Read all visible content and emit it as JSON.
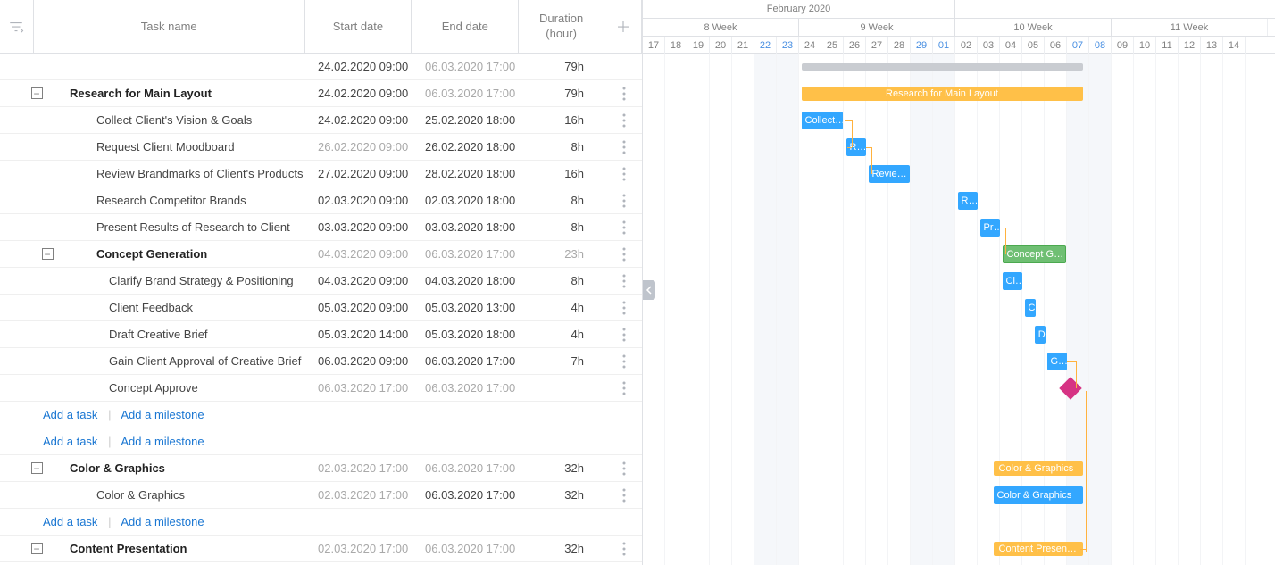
{
  "header": {
    "task_name": "Task name",
    "start_date": "Start date",
    "end_date": "End date",
    "duration_l1": "Duration",
    "duration_l2": "(hour)"
  },
  "timeline_header": {
    "month": "February 2020",
    "weeks": [
      "8 Week",
      "9 Week",
      "10 Week",
      "11 Week"
    ],
    "days": [
      "17",
      "18",
      "19",
      "20",
      "21",
      "22",
      "23",
      "24",
      "25",
      "26",
      "27",
      "28",
      "29",
      "01",
      "02",
      "03",
      "04",
      "05",
      "06",
      "07",
      "08",
      "09",
      "10",
      "11",
      "12",
      "13",
      "14"
    ]
  },
  "links": {
    "add_task": "Add a task",
    "add_milestone": "Add a milestone"
  },
  "rows": [
    {
      "id": "root",
      "lvl": 0,
      "name": "",
      "start": "24.02.2020 09:00",
      "end": "06.03.2020 17:00",
      "dur": "79h"
    },
    {
      "id": "research",
      "lvl": 1,
      "name": "Research for Main Layout",
      "start": "24.02.2020 09:00",
      "end": "06.03.2020 17:00",
      "dur": "79h",
      "summary": true
    },
    {
      "id": "collect",
      "lvl": 2,
      "name": "Collect Client's Vision & Goals",
      "start": "24.02.2020 09:00",
      "end": "25.02.2020 18:00",
      "dur": "16h"
    },
    {
      "id": "mood",
      "lvl": 2,
      "name": "Request Client Moodboard",
      "start": "26.02.2020 09:00",
      "end": "26.02.2020 18:00",
      "dur": "8h",
      "dim_start": true
    },
    {
      "id": "brand",
      "lvl": 2,
      "name": "Review Brandmarks of Client's Products",
      "start": "27.02.2020 09:00",
      "end": "28.02.2020 18:00",
      "dur": "16h"
    },
    {
      "id": "comp",
      "lvl": 2,
      "name": "Research Competitor Brands",
      "start": "02.03.2020 09:00",
      "end": "02.03.2020 18:00",
      "dur": "8h"
    },
    {
      "id": "present",
      "lvl": 2,
      "name": "Present Results of Research to Client",
      "start": "03.03.2020 09:00",
      "end": "03.03.2020 18:00",
      "dur": "8h"
    },
    {
      "id": "concept",
      "lvl": 2,
      "name": "Concept Generation",
      "start": "04.03.2020 09:00",
      "end": "06.03.2020 17:00",
      "dur": "23h",
      "summary": true,
      "dim": true
    },
    {
      "id": "clarify",
      "lvl": 3,
      "name": "Clarify Brand Strategy & Positioning",
      "start": "04.03.2020 09:00",
      "end": "04.03.2020 18:00",
      "dur": "8h"
    },
    {
      "id": "feedback",
      "lvl": 3,
      "name": "Client Feedback",
      "start": "05.03.2020 09:00",
      "end": "05.03.2020 13:00",
      "dur": "4h"
    },
    {
      "id": "draft",
      "lvl": 3,
      "name": "Draft Creative Brief",
      "start": "05.03.2020 14:00",
      "end": "05.03.2020 18:00",
      "dur": "4h"
    },
    {
      "id": "approval",
      "lvl": 3,
      "name": "Gain Client Approval of Creative Brief",
      "start": "06.03.2020 09:00",
      "end": "06.03.2020 17:00",
      "dur": "7h"
    },
    {
      "id": "approve",
      "lvl": 3,
      "name": "Concept Approve",
      "start": "06.03.2020 17:00",
      "end": "06.03.2020 17:00",
      "dur": "",
      "dim": true
    },
    {
      "id": "color",
      "lvl": 1,
      "name": "Color & Graphics",
      "start": "02.03.2020 17:00",
      "end": "06.03.2020 17:00",
      "dur": "32h",
      "summary": true,
      "dim_start": true
    },
    {
      "id": "color2",
      "lvl": 2,
      "name": "Color & Graphics",
      "start": "02.03.2020 17:00",
      "end": "06.03.2020 17:00",
      "dur": "32h",
      "dim_start": true
    },
    {
      "id": "content",
      "lvl": 1,
      "name": "Content Presentation",
      "start": "02.03.2020 17:00",
      "end": "06.03.2020 17:00",
      "dur": "32h",
      "summary": true,
      "dim_start": true
    }
  ],
  "bars": {
    "root_shade": {
      "label": ""
    },
    "research_summary": {
      "label": "Research for Main Layout"
    },
    "collect": {
      "label": "Collect…"
    },
    "mood": {
      "label": "R…"
    },
    "brand": {
      "label": "Revie…"
    },
    "comp": {
      "label": "R…"
    },
    "present": {
      "label": "Pr…"
    },
    "concept": {
      "label": "Concept G…"
    },
    "clarify": {
      "label": "Cl…"
    },
    "feedback": {
      "label": "C"
    },
    "draft": {
      "label": "D"
    },
    "approval": {
      "label": "G…"
    },
    "color_s": {
      "label": "Color & Graphics"
    },
    "color_t": {
      "label": "Color & Graphics"
    },
    "content_s": {
      "label": "Content Presen…"
    }
  }
}
